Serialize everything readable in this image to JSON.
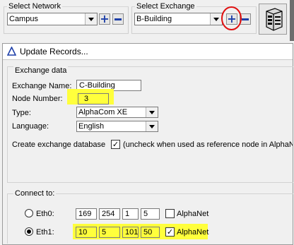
{
  "toolbar": {
    "network_label": "Select Network",
    "network_value": "Campus",
    "exchange_label": "Select Exchange",
    "exchange_value": "B-Building"
  },
  "dialog": {
    "title": "Update Records...",
    "section_exchange": "Exchange data",
    "exchange_name_label": "Exchange Name:",
    "exchange_name_value": "C-Building",
    "node_number_label": "Node Number:",
    "node_number_value": "3",
    "type_label": "Type:",
    "type_value": "AlphaCom XE",
    "language_label": "Language:",
    "language_value": "English",
    "create_db_label": "Create exchange database",
    "create_db_note": "(uncheck when used as reference node in AlphaNet",
    "connect_label": "Connect to:",
    "eth0": {
      "label": "Eth0:",
      "ip": [
        "169",
        "254",
        "1",
        "5"
      ],
      "alphanet_label": "AlphaNet",
      "alphanet_checked": false
    },
    "eth1": {
      "label": "Eth1:",
      "ip": [
        "10",
        "5",
        "101",
        "50"
      ],
      "alphanet_label": "AlphaNet",
      "alphanet_checked": true
    }
  },
  "colors": {
    "highlight": "#ffff3c",
    "annotation_circle": "#e01010",
    "accent_blue": "#1d3fa8"
  }
}
